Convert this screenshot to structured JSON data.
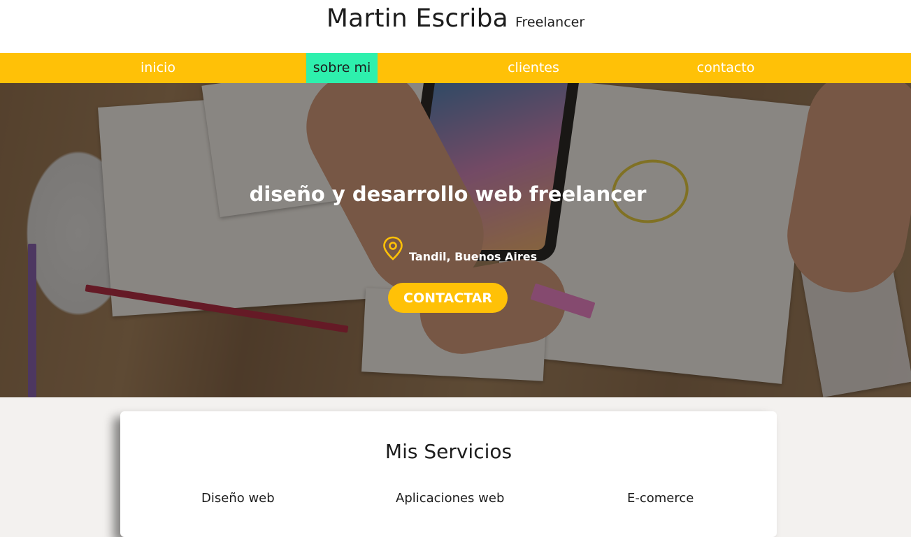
{
  "header": {
    "name": "Martin Escriba",
    "role": "Freelancer"
  },
  "nav": {
    "items": [
      {
        "label": "inicio",
        "active": false
      },
      {
        "label": "sobre mi",
        "active": true
      },
      {
        "label": "clientes",
        "active": false
      },
      {
        "label": "contacto",
        "active": false
      }
    ]
  },
  "hero": {
    "title": "diseño y desarrollo web freelancer",
    "location_icon": "map-pin-icon",
    "location": "Tandil, Buenos Aires",
    "cta_label": "CONTACTAR"
  },
  "services": {
    "title": "Mis Servicios",
    "items": [
      "Diseño web",
      "Aplicaciones web",
      "E-comerce"
    ]
  },
  "colors": {
    "accent": "#ffc107",
    "active_nav": "#2ef0ad",
    "text": "#1c1c1c",
    "white": "#ffffff"
  }
}
